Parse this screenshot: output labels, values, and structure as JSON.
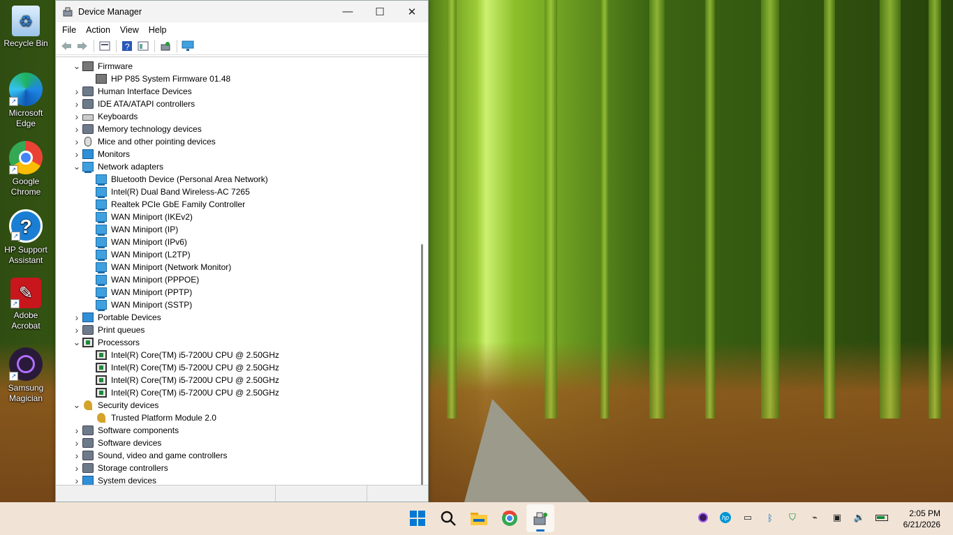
{
  "desktop": {
    "icons": [
      {
        "label_1": "Recycle Bin",
        "label_2": "",
        "icon": "recycle-bin-icon"
      },
      {
        "label_1": "Microsoft",
        "label_2": "Edge",
        "icon": "edge-icon"
      },
      {
        "label_1": "Google",
        "label_2": "Chrome",
        "icon": "chrome-icon"
      },
      {
        "label_1": "HP Support",
        "label_2": "Assistant",
        "icon": "hp-support-icon"
      },
      {
        "label_1": "Adobe",
        "label_2": "Acrobat",
        "icon": "acrobat-icon"
      },
      {
        "label_1": "Samsung",
        "label_2": "Magician",
        "icon": "samsung-magician-icon"
      }
    ]
  },
  "window": {
    "title": "Device Manager",
    "controls": {
      "minimize": "—",
      "maximize": "☐",
      "close": "✕"
    },
    "menu": [
      "File",
      "Action",
      "View",
      "Help"
    ],
    "tree": [
      {
        "label": "Firmware",
        "level": 0,
        "expanded": true,
        "icon": "fw"
      },
      {
        "label": "HP P85 System Firmware 01.48",
        "level": 1,
        "icon": "fw"
      },
      {
        "label": "Human Interface Devices",
        "level": 0,
        "expanded": false,
        "icon": "cat"
      },
      {
        "label": "IDE ATA/ATAPI controllers",
        "level": 0,
        "expanded": false,
        "icon": "cat"
      },
      {
        "label": "Keyboards",
        "level": 0,
        "expanded": false,
        "icon": "kb"
      },
      {
        "label": "Memory technology devices",
        "level": 0,
        "expanded": false,
        "icon": "cat"
      },
      {
        "label": "Mice and other pointing devices",
        "level": 0,
        "expanded": false,
        "icon": "mouse"
      },
      {
        "label": "Monitors",
        "level": 0,
        "expanded": false,
        "icon": "mon"
      },
      {
        "label": "Network adapters",
        "level": 0,
        "expanded": true,
        "icon": "net"
      },
      {
        "label": "Bluetooth Device (Personal Area Network)",
        "level": 1,
        "icon": "net"
      },
      {
        "label": "Intel(R) Dual Band Wireless-AC 7265",
        "level": 1,
        "icon": "net"
      },
      {
        "label": "Realtek PCIe GbE Family Controller",
        "level": 1,
        "icon": "net"
      },
      {
        "label": "WAN Miniport (IKEv2)",
        "level": 1,
        "icon": "net"
      },
      {
        "label": "WAN Miniport (IP)",
        "level": 1,
        "icon": "net"
      },
      {
        "label": "WAN Miniport (IPv6)",
        "level": 1,
        "icon": "net"
      },
      {
        "label": "WAN Miniport (L2TP)",
        "level": 1,
        "icon": "net"
      },
      {
        "label": "WAN Miniport (Network Monitor)",
        "level": 1,
        "icon": "net"
      },
      {
        "label": "WAN Miniport (PPPOE)",
        "level": 1,
        "icon": "net"
      },
      {
        "label": "WAN Miniport (PPTP)",
        "level": 1,
        "icon": "net"
      },
      {
        "label": "WAN Miniport (SSTP)",
        "level": 1,
        "icon": "net"
      },
      {
        "label": "Portable Devices",
        "level": 0,
        "expanded": false,
        "icon": "mon"
      },
      {
        "label": "Print queues",
        "level": 0,
        "expanded": false,
        "icon": "cat"
      },
      {
        "label": "Processors",
        "level": 0,
        "expanded": true,
        "icon": "chip"
      },
      {
        "label": "Intel(R) Core(TM) i5-7200U CPU @ 2.50GHz",
        "level": 1,
        "icon": "chip"
      },
      {
        "label": "Intel(R) Core(TM) i5-7200U CPU @ 2.50GHz",
        "level": 1,
        "icon": "chip"
      },
      {
        "label": "Intel(R) Core(TM) i5-7200U CPU @ 2.50GHz",
        "level": 1,
        "icon": "chip"
      },
      {
        "label": "Intel(R) Core(TM) i5-7200U CPU @ 2.50GHz",
        "level": 1,
        "icon": "chip"
      },
      {
        "label": "Security devices",
        "level": 0,
        "expanded": true,
        "icon": "key"
      },
      {
        "label": "Trusted Platform Module 2.0",
        "level": 1,
        "icon": "key"
      },
      {
        "label": "Software components",
        "level": 0,
        "expanded": false,
        "icon": "cat"
      },
      {
        "label": "Software devices",
        "level": 0,
        "expanded": false,
        "icon": "cat"
      },
      {
        "label": "Sound, video and game controllers",
        "level": 0,
        "expanded": false,
        "icon": "cat"
      },
      {
        "label": "Storage controllers",
        "level": 0,
        "expanded": false,
        "icon": "cat"
      },
      {
        "label": "System devices",
        "level": 0,
        "expanded": false,
        "icon": "mon"
      }
    ]
  },
  "taskbar": {
    "apps": [
      "start-icon",
      "search-icon",
      "file-explorer-icon",
      "chrome-icon",
      "device-manager-icon"
    ],
    "tray": [
      "samsung-magician-tray-icon",
      "hp-tray-icon",
      "display-tray-icon",
      "bluetooth-tray-icon",
      "security-tray-icon",
      "usb-tray-icon",
      "network-tray-icon",
      "volume-tray-icon",
      "battery-tray-icon"
    ],
    "time": "2:05 PM",
    "date": "6/21/2026"
  },
  "colors": {
    "accent": "#0067c0",
    "taskbar": "#f1e4d7"
  }
}
